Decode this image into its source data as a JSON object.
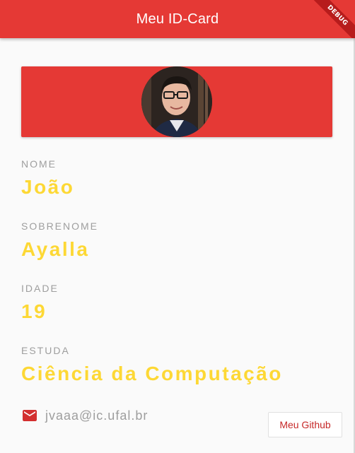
{
  "app_bar": {
    "title": "Meu ID-Card",
    "debug_banner": "DEBUG",
    "color": "#e53935"
  },
  "profile": {
    "avatar": "profile-photo"
  },
  "fields": [
    {
      "label": "NOME",
      "value": "João"
    },
    {
      "label": "SOBRENOME",
      "value": "Ayalla"
    },
    {
      "label": "IDADE",
      "value": "19"
    },
    {
      "label": "ESTUDA",
      "value": "Ciência da Computação"
    }
  ],
  "contact": {
    "icon": "mail-icon",
    "email": "jvaaa@ic.ufal.br"
  },
  "github_button": {
    "label": "Meu Github"
  },
  "colors": {
    "accent": "#e53935",
    "value_text": "#fdd835",
    "label_text": "#9e9e9e",
    "button_text": "#c62828"
  }
}
